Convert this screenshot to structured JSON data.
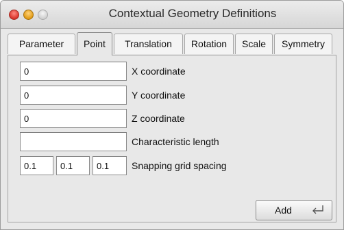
{
  "window": {
    "title": "Contextual Geometry Definitions"
  },
  "tabs": [
    {
      "label": "Parameter",
      "active": false
    },
    {
      "label": "Point",
      "active": true
    },
    {
      "label": "Translation",
      "active": false
    },
    {
      "label": "Rotation",
      "active": false
    },
    {
      "label": "Scale",
      "active": false
    },
    {
      "label": "Symmetry",
      "active": false
    }
  ],
  "point_form": {
    "x": {
      "value": "0",
      "label": "X coordinate"
    },
    "y": {
      "value": "0",
      "label": "Y coordinate"
    },
    "z": {
      "value": "0",
      "label": "Z coordinate"
    },
    "characteristic_length": {
      "value": "",
      "label": "Characteristic length"
    },
    "snapping": {
      "values": [
        "0.1",
        "0.1",
        "0.1"
      ],
      "label": "Snapping grid spacing"
    }
  },
  "actions": {
    "add_label": "Add",
    "add_icon": "return-arrow-icon"
  },
  "colors": {
    "close_light": "#d8332a",
    "minimize_light": "#e09a14",
    "zoom_light": "#cfcfcf",
    "window_bg": "#e8e8e8"
  }
}
